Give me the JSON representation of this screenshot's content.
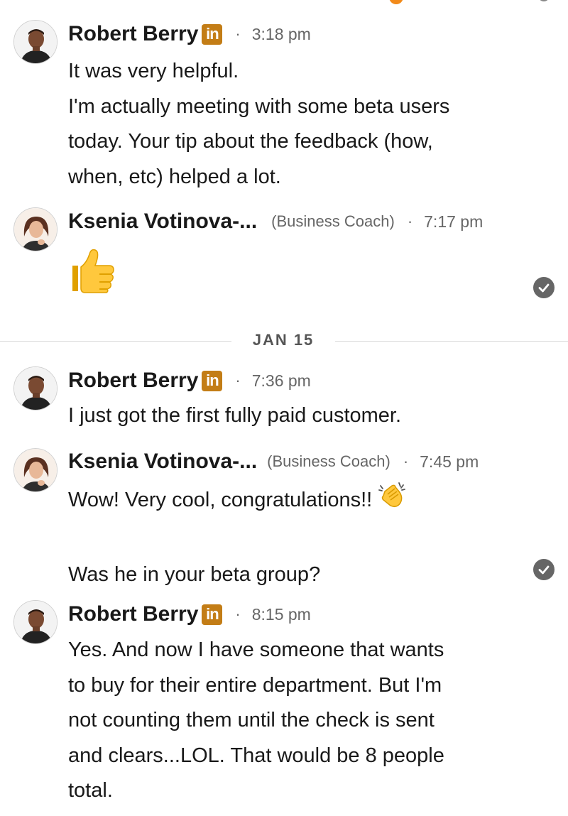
{
  "messages": [
    {
      "sender": "Robert Berry",
      "linkedin_badge": "in",
      "time": "3:18 pm",
      "lines": [
        "It was very helpful.",
        "I'm actually meeting with some beta users",
        "today. Your tip about the feedback (how,",
        "when, etc) helped a lot."
      ]
    },
    {
      "sender": "Ksenia Votinova-...",
      "role": "(Business Coach)",
      "time": "7:17 pm",
      "emoji": "thumbs-up-emoji"
    },
    {
      "sender": "Robert Berry",
      "linkedin_badge": "in",
      "time": "7:36 pm",
      "lines": [
        "I just got the first fully paid customer."
      ]
    },
    {
      "sender": "Ksenia Votinova-...",
      "role": "(Business Coach)",
      "time": "7:45 pm",
      "lines": [
        "Wow! Very cool, congratulations!!",
        "",
        "Was he in your beta group?"
      ],
      "emoji": "clapping-hands-emoji"
    },
    {
      "sender": "Robert Berry",
      "linkedin_badge": "in",
      "time": "8:15 pm",
      "lines": [
        "Yes. And now I have someone that wants",
        "to buy for their entire department. But I'm",
        "not counting them until the check is sent",
        "and clears...LOL. That would be 8 people",
        "total."
      ]
    }
  ],
  "date_divider": "JAN 15",
  "separator": "·",
  "icons": {
    "read_receipt": "check-circle-icon",
    "linkedin": "linkedin-badge-icon"
  },
  "colors": {
    "linkedin_badge": "#c37d16",
    "read_receipt": "#666666",
    "text": "#191919",
    "meta": "#666666"
  }
}
